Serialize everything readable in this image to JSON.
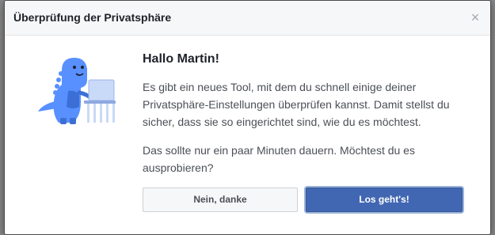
{
  "dialog": {
    "title": "Überprüfung der Privatsphäre",
    "close_icon": "close-icon",
    "close_glyph": "×"
  },
  "illustration": {
    "icon": "dinosaur-laptop-icon",
    "colors": {
      "dino": "#5890ff",
      "dino_dark": "#3b6fd6",
      "laptop": "#c9d9f8"
    }
  },
  "content": {
    "greeting": "Hallo Martin!",
    "paragraph1": "Es gibt ein neues Tool, mit dem du schnell einige deiner Privatsphäre-Einstellungen überprüfen kannst. Damit stellst du sicher, dass sie so eingerichtet sind, wie du es möchtest.",
    "paragraph2": "Das sollte nur ein paar Minuten dauern. Möchtest du es ausprobieren?"
  },
  "buttons": {
    "decline_label": "Nein, danke",
    "accept_label": "Los geht's!"
  },
  "colors": {
    "primary": "#4267b2",
    "header_bg": "#f6f7f9",
    "text": "#4b4f56"
  }
}
